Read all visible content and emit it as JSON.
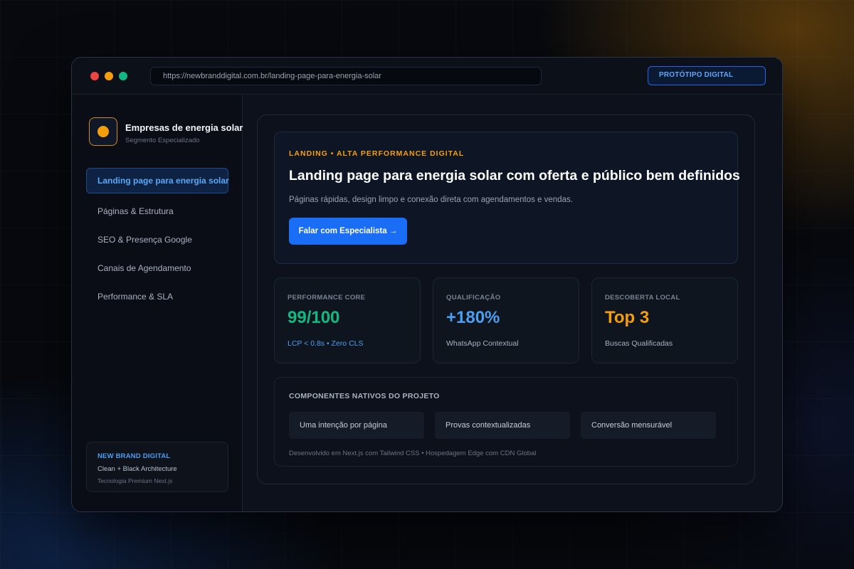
{
  "browser": {
    "url": "https://newbranddigital.com.br/landing-page-para-energia-solar",
    "badge": "PROTÓTIPO DIGITAL"
  },
  "sidebar": {
    "brand_title": "Empresas de energia solar",
    "brand_subtitle": "Segmento Especializado",
    "items": [
      {
        "label": "Landing page para energia solar",
        "active": true
      },
      {
        "label": "Páginas & Estrutura",
        "active": false
      },
      {
        "label": "SEO & Presença Google",
        "active": false
      },
      {
        "label": "Canais de Agendamento",
        "active": false
      },
      {
        "label": "Performance & SLA",
        "active": false
      }
    ],
    "card": {
      "title": "NEW BRAND DIGITAL",
      "line": "Clean + Black Architecture",
      "sub": "Tecnologia Premium Next.js"
    }
  },
  "hero": {
    "eyebrow": "LANDING • ALTA PERFORMANCE DIGITAL",
    "title": "Landing page para energia solar com oferta e público bem definidos",
    "description": "Páginas rápidas, design limpo e conexão direta com agendamentos e vendas.",
    "cta": "Falar com Especialista →"
  },
  "stats": [
    {
      "label": "PERFORMANCE CORE",
      "value": "99/100",
      "note": "LCP < 0.8s • Zero CLS",
      "value_color": "#10b981",
      "note_color": "#4c9fef"
    },
    {
      "label": "QUALIFICAÇÃO",
      "value": "+180%",
      "note": "WhatsApp Contextual",
      "value_color": "#4c9fef",
      "note_color": "#aab2c0"
    },
    {
      "label": "DESCOBERTA LOCAL",
      "value": "Top 3",
      "note": "Buscas Qualificadas",
      "value_color": "#f59e0b",
      "note_color": "#aab2c0"
    }
  ],
  "components": {
    "title": "COMPONENTES NATIVOS DO PROJETO",
    "chips": [
      "Uma intenção por página",
      "Provas contextualizadas",
      "Conversão mensurável"
    ],
    "footer": "Desenvolvido em Next.js com Tailwind CSS • Hospedagem Edge com CDN Global"
  },
  "colors": {
    "accent_blue": "#1a6df5",
    "accent_orange": "#f59e0b",
    "accent_green": "#10b981"
  }
}
